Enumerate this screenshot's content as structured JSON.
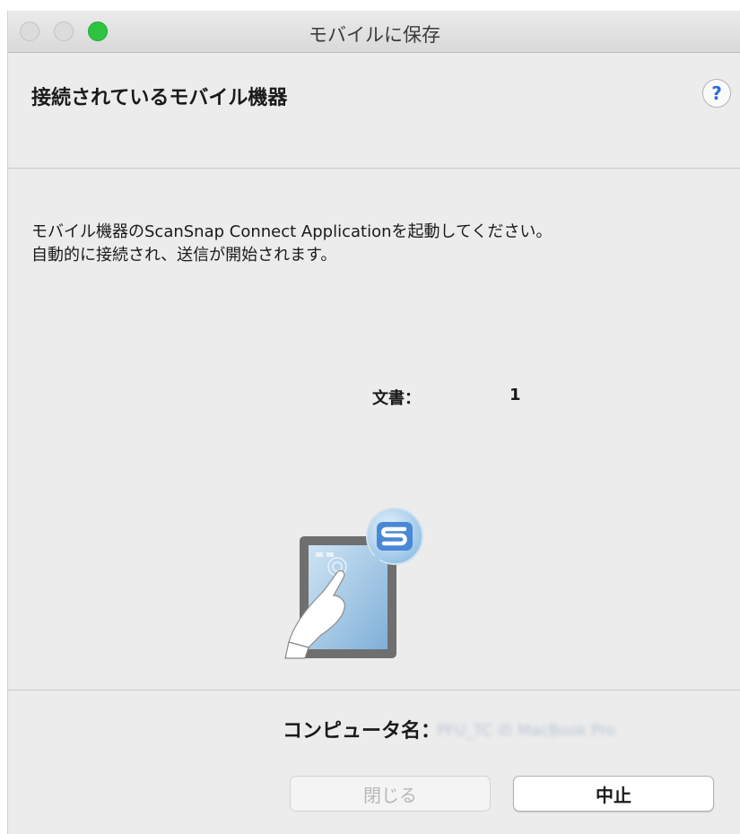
{
  "window": {
    "title": "モバイルに保存"
  },
  "header": {
    "title": "接続されているモバイル機器",
    "help_label": "?"
  },
  "content": {
    "instruction_line1": "モバイル機器のScanSnap Connect Applicationを起動してください。",
    "instruction_line2": "自動的に接続され、送信が開始されます。",
    "document_label": "文書：",
    "document_count": "1"
  },
  "footer": {
    "computer_name_label": "コンピュータ名：",
    "computer_name_value": "PFU_TC の MacBook Pro",
    "close_button": "閉じる",
    "stop_button": "中止"
  },
  "icons": {
    "illustration": "tablet-hand-scansnap-icon",
    "help": "help-icon"
  },
  "colors": {
    "zoom_button": "#2ec441",
    "help_accent": "#2b6fd6",
    "window_bg": "#ececec"
  }
}
